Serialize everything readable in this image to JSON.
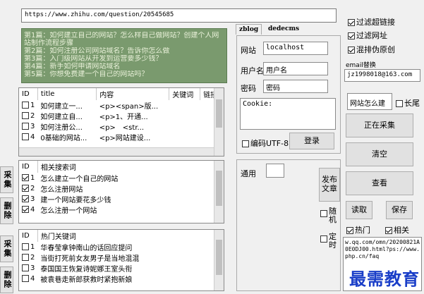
{
  "url": "https://www.zhihu.com/question/20545685",
  "intro_lines": [
    "第1篇：如何建立自己的网站？怎么样自己做网站？创建个人网站制作流程步骤",
    "第2篇：如何注册公司网站域名？告诉你怎么做",
    "第3篇：入门级网站从开发到运营要多少钱？",
    "第4篇：新手如何申请网站域名",
    "第5篇：你想免费建一个自己的网站吗？"
  ],
  "articles": {
    "headers": [
      "ID",
      "title",
      "内容",
      "关键词",
      "链接"
    ],
    "rows": [
      {
        "id": "1",
        "title": "如何建立一...",
        "content": "<p><span>版..."
      },
      {
        "id": "2",
        "title": "如何建立自...",
        "content": "<p>1、开通..."
      },
      {
        "id": "3",
        "title": "如何注册公...",
        "content": "<p>　<str..."
      },
      {
        "id": "4",
        "title": "0基础的网站...",
        "content": "<p>网站建设..."
      }
    ]
  },
  "related": {
    "headers": [
      "ID",
      "相关搜索词"
    ],
    "rows": [
      {
        "id": "1",
        "text": "怎么建立一个自己的网站",
        "checked": true
      },
      {
        "id": "2",
        "text": "怎么注册网站",
        "checked": true
      },
      {
        "id": "3",
        "text": "建一个网站要花多少钱",
        "checked": true
      },
      {
        "id": "4",
        "text": "怎么注册一个网站",
        "checked": true
      }
    ]
  },
  "hot": {
    "headers": [
      "ID",
      "热门关键词"
    ],
    "rows": [
      {
        "id": "1",
        "text": "华春莹拿钟南山的话回应提问",
        "checked": false
      },
      {
        "id": "2",
        "text": "当街打死前女友男子是当地混混",
        "checked": false
      },
      {
        "id": "3",
        "text": "泰国国王恢复诗妮娜王室头衔",
        "checked": false
      },
      {
        "id": "4",
        "text": "被袁巷走新郎获救时紧抱新娘",
        "checked": false
      }
    ]
  },
  "side_tabs": [
    "采集",
    "删除",
    "采集",
    "删除"
  ],
  "tabs": [
    "zblog",
    "dedecms"
  ],
  "form": {
    "site_label": "网站",
    "site_value": "localhost",
    "user_label": "用户名",
    "user_value": "用户名",
    "pass_label": "密码",
    "pass_value": "密码",
    "cookie_value": "Cookie:",
    "encode_label": "编码UTF-8",
    "login_label": "登录"
  },
  "general": {
    "label": "通用"
  },
  "publish_label": "发布文章",
  "random_label": "随机",
  "timing_label": "定时",
  "options": {
    "filter_links": "过滤超链接",
    "filter_url": "过滤网址",
    "mix_original": "混排伪原创"
  },
  "email": {
    "label": "email替换",
    "value": "jz1998018@163.com"
  },
  "search_value": "网站怎么建",
  "tail_label": "长尾",
  "buttons": {
    "collecting": "正在采集",
    "clear": "清空",
    "view": "查看",
    "read": "读取",
    "save": "保存"
  },
  "hot_label": "热门",
  "related_label": "相关",
  "bottom_text": "w.qq.com/omn/20200821A0E0DJ00.html?ps://www.php.cn/faq",
  "watermark": "最需教育"
}
